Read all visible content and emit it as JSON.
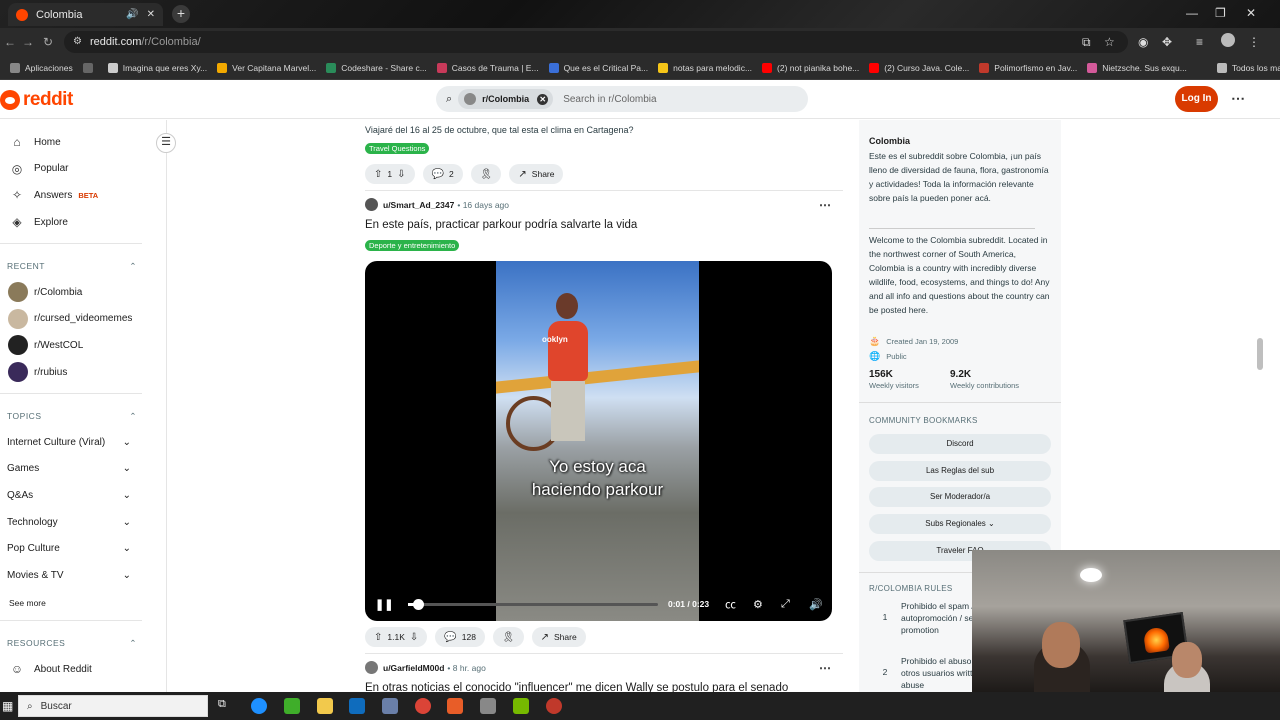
{
  "browser": {
    "tab_title": "Colombia",
    "new_tab": "+",
    "url_host": "reddit.com",
    "url_path": "/r/Colombia/",
    "bookmarks": [
      {
        "label": "Aplicaciones",
        "color": "#888888"
      },
      {
        "label": "",
        "color": "#666666"
      },
      {
        "label": "Imagina que eres Xy...",
        "color": "#cccccc"
      },
      {
        "label": "Ver Capitana Marvel...",
        "color": "#f2a900"
      },
      {
        "label": "Codeshare - Share c...",
        "color": "#2a8c5a"
      },
      {
        "label": "Casos de Trauma | E...",
        "color": "#c83a5a"
      },
      {
        "label": "Que es el Critical Pa...",
        "color": "#3a6fd8"
      },
      {
        "label": "notas para melodic...",
        "color": "#f5c518"
      },
      {
        "label": "(2) not pianika bohe...",
        "color": "#ff0000"
      },
      {
        "label": "(2) Curso Java. Cole...",
        "color": "#ff0000"
      },
      {
        "label": "Polimorfismo en Jav...",
        "color": "#c0392b"
      },
      {
        "label": "Nietzsche. Sus exqu...",
        "color": "#d45a9a"
      },
      {
        "label": "Todos los marcadores",
        "color": "#bbbbbb"
      }
    ]
  },
  "header": {
    "logo_text": "reddit",
    "search_chip": "r/Colombia",
    "search_placeholder": "Search in r/Colombia",
    "login_label": "Log In",
    "more": "⋯"
  },
  "leftnav": {
    "items": [
      {
        "label": "Home",
        "icon": "⌂"
      },
      {
        "label": "Popular",
        "icon": "◎"
      },
      {
        "label": "Answers",
        "icon": "✧",
        "badge": "BETA"
      },
      {
        "label": "Explore",
        "icon": "◈"
      }
    ],
    "recent_title": "RECENT",
    "recent": [
      {
        "label": "r/Colombia",
        "color": "#8a7a5a"
      },
      {
        "label": "r/cursed_videomemes",
        "color": "#c9b8a0"
      },
      {
        "label": "r/WestCOL",
        "color": "#222222"
      },
      {
        "label": "r/rubius",
        "color": "#3a2a5a"
      }
    ],
    "topics_title": "TOPICS",
    "topics": [
      "Internet Culture (Viral)",
      "Games",
      "Q&As",
      "Technology",
      "Pop Culture",
      "Movies & TV"
    ],
    "see_more": "See more",
    "resources_title": "RESOURCES",
    "resources": [
      {
        "label": "About Reddit",
        "icon": "☺"
      }
    ]
  },
  "feed": {
    "post0": {
      "body": "Viajaré del 16 al 25 de octubre, que tal esta el clima en Cartagena?",
      "flair": "Travel Questions",
      "flair_color": "#2bb34a",
      "votes": "1",
      "comments": "2",
      "share": "Share"
    },
    "post1": {
      "user": "u/Smart_Ad_2347",
      "ago": "16 days ago",
      "title": "En este país, practicar parkour podría salvarte la vida",
      "flair": "Deporte y entretenimiento",
      "flair_color": "#2bb34a",
      "subtitle_line1": "Yo estoy aca",
      "subtitle_line2": "haciendo parkour",
      "shirt_text": "ooklyn",
      "time": "0:01 / 0:23",
      "progress": 0.04,
      "votes": "1.1K",
      "comments": "128",
      "share": "Share"
    },
    "post2": {
      "user": "u/GarfieldM00d",
      "ago": "8 hr. ago",
      "title": "En otras noticias el conocido \"influencer\" me dicen Wally se postulo para el senado"
    }
  },
  "sidebar": {
    "name": "Colombia",
    "desc_es": "Este es el subreddit sobre Colombia, ¡un país lleno de diversidad de fauna, flora, gastronomía y actividades! Toda la información relevante sobre país la pueden poner acá.",
    "desc_en": "Welcome to the Colombia subreddit. Located in the northwest corner of South America, Colombia is a country with incredibly diverse wildlife, food, ecosystems, and things to do! Any and all info and questions about the country can be posted here.",
    "created": "Created Jan 19, 2009",
    "visibility": "Public",
    "visitors": "156K",
    "visitors_label": "Weekly visitors",
    "contribs": "9.2K",
    "contribs_label": "Weekly contributions",
    "bookmarks_title": "COMMUNITY BOOKMARKS",
    "bookmarks": [
      "Discord",
      "Las Reglas del sub",
      "Ser Moderador/a",
      "Subs Regionales",
      "Traveler FAQ"
    ],
    "rules_title": "R/COLOMBIA RULES",
    "rules": [
      {
        "n": "1",
        "text": "Prohibido el spam / autopromoción / self promotion"
      },
      {
        "n": "2",
        "text": "Prohibido el abuso contra otros usuarios written/verbal abuse"
      }
    ]
  },
  "taskbar": {
    "search_placeholder": "Buscar"
  }
}
